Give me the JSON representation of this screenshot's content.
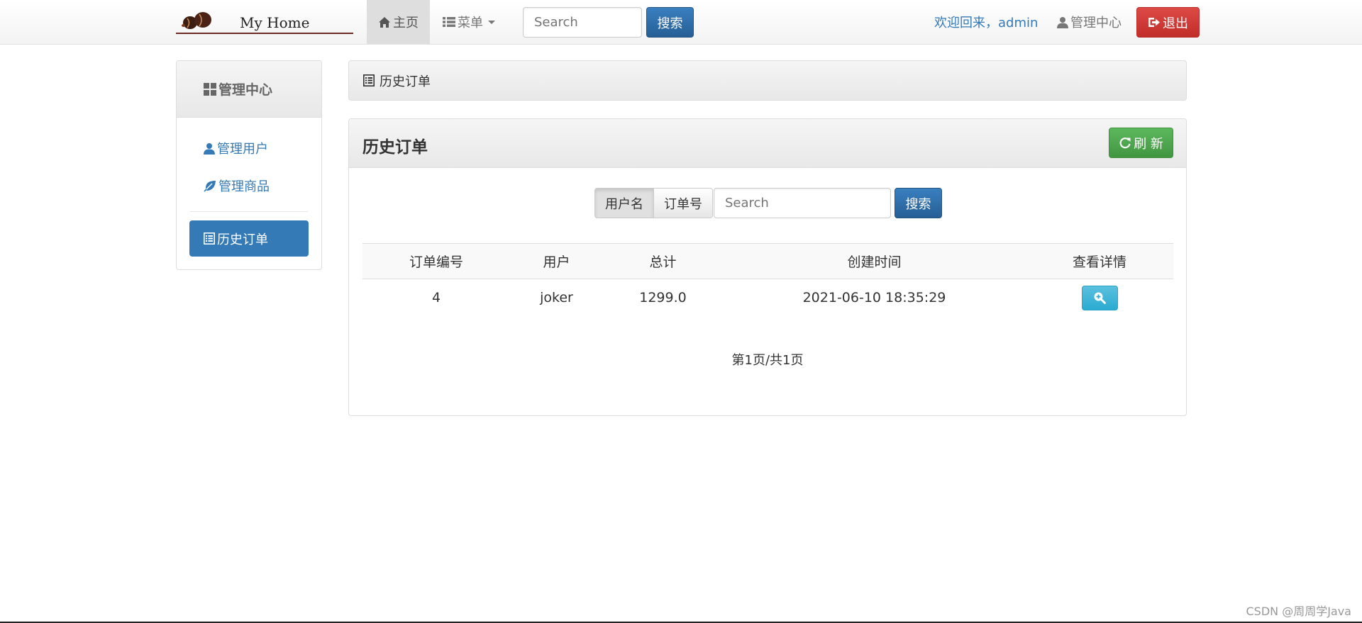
{
  "navbar": {
    "brand": "My Home",
    "home_label": "主页",
    "menu_label": "菜单",
    "search_placeholder": "Search",
    "search_button": "搜索",
    "welcome": "欢迎回来，admin",
    "admin_center": "管理中心",
    "logout": "退出"
  },
  "sidebar": {
    "heading": "管理中心",
    "items": [
      {
        "label": "管理用户",
        "icon": "user-icon"
      },
      {
        "label": "管理商品",
        "icon": "leaf-icon"
      },
      {
        "label": "历史订单",
        "icon": "list-alt-icon",
        "active": true
      }
    ]
  },
  "breadcrumb": {
    "label": "历史订单"
  },
  "panel": {
    "title": "历史订单",
    "refresh_label": "刷 新",
    "search_options": [
      "用户名",
      "订单号"
    ],
    "search_placeholder": "Search",
    "search_button": "搜索",
    "table": {
      "headers": [
        "订单编号",
        "用户",
        "总计",
        "创建时间",
        "查看详情"
      ],
      "rows": [
        {
          "id": "4",
          "user": "joker",
          "total": "1299.0",
          "created": "2021-06-10 18:35:29"
        }
      ]
    },
    "pagination": "第1页/共1页"
  },
  "watermark": "CSDN @周周学Java",
  "colors": {
    "primary": "#337ab7",
    "success": "#5cb85c",
    "danger": "#d9534f",
    "info": "#5bc0de"
  }
}
